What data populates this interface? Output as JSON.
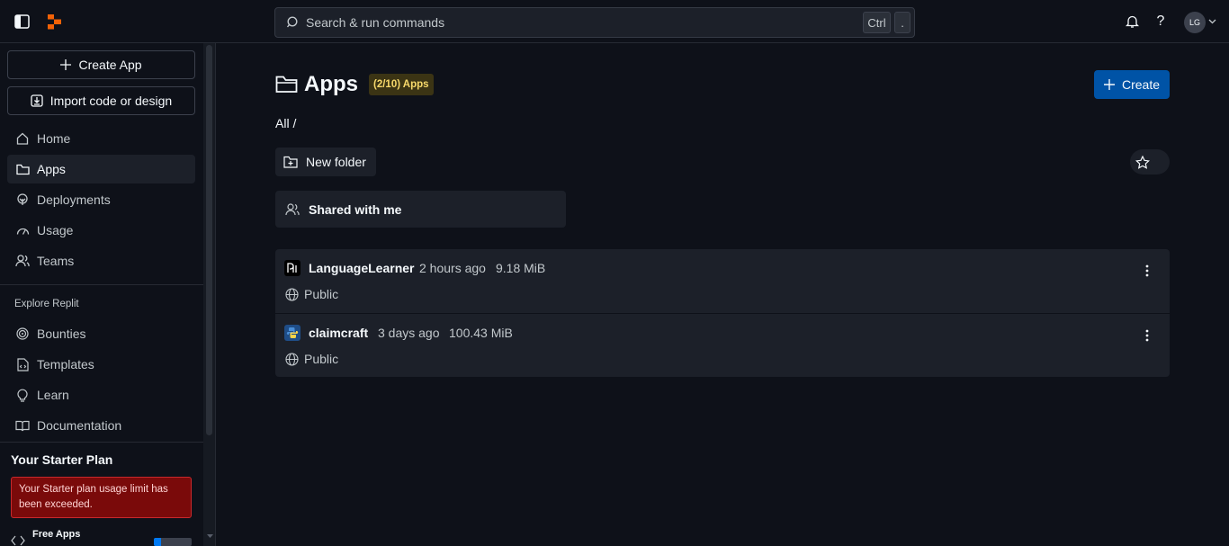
{
  "topbar": {
    "search_placeholder": "Search & run commands",
    "shortcut_key1": "Ctrl",
    "shortcut_key2": ".",
    "avatar_initials": "LG",
    "help_label": "?"
  },
  "sidebar": {
    "create_app": "Create App",
    "import": "Import code or design",
    "nav": [
      {
        "label": "Home",
        "icon": "home-icon"
      },
      {
        "label": "Apps",
        "icon": "folder-icon",
        "active": true
      },
      {
        "label": "Deployments",
        "icon": "deployments-icon"
      },
      {
        "label": "Usage",
        "icon": "usage-icon"
      },
      {
        "label": "Teams",
        "icon": "teams-icon"
      }
    ],
    "explore_label": "Explore Replit",
    "explore": [
      {
        "label": "Bounties",
        "icon": "bounties-icon"
      },
      {
        "label": "Templates",
        "icon": "templates-icon"
      },
      {
        "label": "Learn",
        "icon": "lightbulb-icon"
      },
      {
        "label": "Documentation",
        "icon": "book-icon"
      }
    ],
    "plan_title": "Your Starter Plan",
    "plan_alert": "Your Starter plan usage limit has been exceeded.",
    "free_apps_label": "Free Apps",
    "free_apps_usage": 0.2
  },
  "main": {
    "title": "Apps",
    "apps_badge": "(2/10) Apps",
    "create_label": "Create",
    "breadcrumb": "All /",
    "new_folder": "New folder",
    "shared": "Shared with me",
    "apps": [
      {
        "name": "LanguageLearner",
        "time": "2 hours ago",
        "size": "9.18 MiB",
        "visibility": "Public",
        "icon": "language-learner-icon"
      },
      {
        "name": "claimcraft",
        "time": "3 days ago",
        "size": "100.43 MiB",
        "visibility": "Public",
        "icon": "python-icon"
      }
    ]
  },
  "colors": {
    "background": "#0e1119",
    "surface": "#1c2029",
    "accent": "#0053a6",
    "logo": "#f26207",
    "alert": "#7a0a0a",
    "badge_text": "#f7d96b"
  }
}
